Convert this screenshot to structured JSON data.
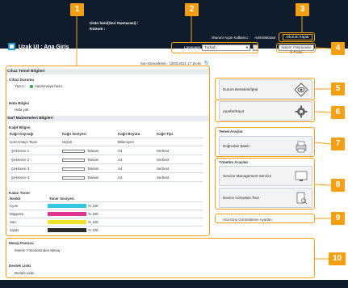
{
  "header": {
    "device_info": "Ürün İsmi(Seri Numarası) :",
    "location": "Konum :",
    "app_title": "Uzak UI : Ana Giriş",
    "user_label": "Oturum Açan Kullanıcı :",
    "user_name": "Administrator",
    "logout": "Oturum Kapat",
    "language_label": "Language:",
    "language_value": "Turkish",
    "email_button": "Sistem Yöneticisine E-Posta"
  },
  "status_panel": {
    "timestamp": "Son Güncelleme : 13/03 2021 17:15:46",
    "device_info_title": "Cihaz Temel Bilgileri",
    "device_status_title": "Cihaz Durumu",
    "printer_label": "Yazıcı :",
    "printer_status": "Yazdırmaya hazır.",
    "error_info_title": "Hata Bilgisi",
    "error_text": "Hata yok.",
    "consumables_title": "Sarf Malzemeleri Bilgileri",
    "paper_info_title": "Kağıt Bilgisi",
    "paper_headers": [
      "Kağıt Kaynağı",
      "Kağıt Seviyesi",
      "Kağıt Boyutu",
      "Kağıt Tipi"
    ],
    "paper_rows": [
      {
        "source": "Çok-Amaçlı Tepsi",
        "level": "Hiçbiri",
        "size": "Bilinmiyen",
        "type": ""
      },
      {
        "source": "Çekmece 1",
        "level": "Tamam",
        "size": "A4",
        "type": "Serbest"
      },
      {
        "source": "Çekmece 2",
        "level": "Tamam",
        "size": "A4",
        "type": "Serbest"
      },
      {
        "source": "Çekmece 3",
        "level": "Tamam",
        "size": "A4",
        "type": "Serbest"
      },
      {
        "source": "Çekmece 4",
        "level": "Tamam",
        "size": "A4",
        "type": "Serbest"
      }
    ],
    "toner_title": "Kalan Toner",
    "toner_headers": [
      "Renkli",
      "Toner Seviyesi"
    ],
    "toner_rows": [
      {
        "color": "Cyan",
        "value": "% 100",
        "hex": "#35c6e6"
      },
      {
        "color": "Magenta",
        "value": "% 100",
        "hex": "#e0348f"
      },
      {
        "color": "Sarı",
        "value": "% 100",
        "hex": "#f2e12c"
      },
      {
        "color": "Siyah",
        "value": "% 100",
        "hex": "#2b2b2b"
      }
    ]
  },
  "right_panel": {
    "monitor_label": "Durum Denetimi/İptal",
    "settings_label": "Ayarlar/Kayıt",
    "basic_tools_title": "Temel Araçlar",
    "direct_print_label": "Doğrudan Baskı",
    "management_title": "Yönetim Araçları",
    "service_mgmt_label": "Service Management Service",
    "device_activation_label": "Device Activation Tool",
    "portal_settings_link": "Ana Giriş Görüntüleme Ayarları"
  },
  "message_panel": {
    "title": "Mesaj Panosu",
    "message": "Sistem Yöneticisinden Mesaj :",
    "support_title": "Destek Linki",
    "support_link": "Destek Linki"
  },
  "callouts": [
    "1",
    "2",
    "3",
    "4",
    "5",
    "6",
    "7",
    "8",
    "9",
    "10"
  ],
  "colors": {
    "accent": "#f5a014",
    "header_bg": "#0f1c2c"
  }
}
